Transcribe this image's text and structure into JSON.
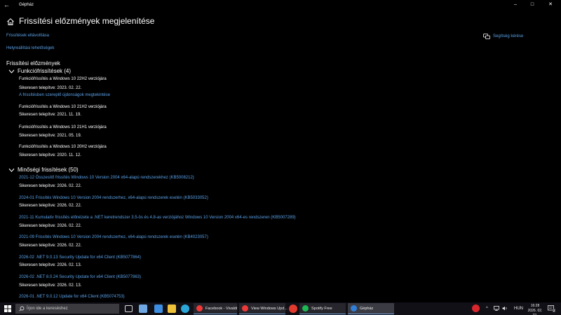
{
  "window": {
    "title": "Gépház",
    "back_glyph": "←",
    "minimize_glyph": "–",
    "maximize_glyph": "□",
    "close_glyph": "✕"
  },
  "header": {
    "title": "Frissítési előzmények megjelenítése"
  },
  "links": {
    "uninstall": "Frissítések eltávolítása",
    "recovery": "Helyreállítási lehetőségek",
    "help": "Segítség kérése"
  },
  "history": {
    "heading": "Frissítési előzmények",
    "feature_group": "Funkciófrissítések (4)",
    "feature_items": [
      {
        "title": "Funkciófrissítés a Windows 10 22H2 verziójára",
        "status": "Sikeresen telepítve: 2023. 02. 22.",
        "extra_link": "A frissítésben szereplő újdonságok megtekintése"
      },
      {
        "title": "Funkciófrissítés a Windows 10 21H2 verziójára",
        "status": "Sikeresen telepítve: 2021. 11. 19."
      },
      {
        "title": "Funkciófrissítés a Windows 10 21H1 verziójára",
        "status": "Sikeresen telepítve: 2021. 05. 19."
      },
      {
        "title": "Funkciófrissítés a Windows 10 20H2 verziójára",
        "status": "Sikeresen telepítve: 2020. 11. 12."
      }
    ],
    "quality_group": "Minőségi frissítések (50)",
    "quality_items": [
      {
        "title": "2021-12 Összesítő frissítés Windows 10 Version 2004 x64-alapú rendszerekhez (KB5008212)",
        "status": "Sikeresen telepítve: 2026. 02. 22."
      },
      {
        "title": "2024-01 Frissítés Windows 10 Version 2004 rendszerhez, x64-alapú rendszerek esetén (KB5033052)",
        "status": "Sikeresen telepítve: 2026. 02. 22."
      },
      {
        "title": "2021-11 Kumulatív frissítés előnézete a .NET keretrendszer 3.5-ös és 4.8-as verziójához Windows 10 Version 2004 x64-es rendszeren (KB5007289)",
        "status": "Sikeresen telepítve: 2026. 02. 22."
      },
      {
        "title": "2021-09 Frissítés Windows 10 Version 2004 rendszerhez, x64-alapú rendszerek esetén (KB4023057)",
        "status": "Sikeresen telepítve: 2026. 02. 22."
      },
      {
        "title": "2026-02 .NET 9.0.13 Security Update for x64 Client (KB5077864)",
        "status": "Sikeresen telepítve: 2026. 02. 13."
      },
      {
        "title": "2026-02 .NET 8.0.24 Security Update for x64 Client (KB5077863)",
        "status": "Sikeresen telepítve: 2026. 02. 13."
      },
      {
        "title": "2026-01 .NET 9.0.12 Update for x64 Client (KB5074753)",
        "status": ""
      }
    ]
  },
  "taskbar": {
    "search_placeholder": "Írjon ide a kereséshez",
    "buttons": [
      {
        "label": "Facebook - Vivaldi",
        "color": "#ef3939"
      },
      {
        "label": "View Windows Upd...",
        "color": "#ef3939"
      },
      {
        "label": "Spotify Free",
        "color": "#1db954"
      },
      {
        "label": "Gépház",
        "color": "#2f7fd8"
      }
    ],
    "language": "HUN",
    "time": "16:28",
    "date": "2026. 02. 22.",
    "chevron_glyph": "^",
    "notif_badge": "2"
  },
  "colors": {
    "background": "#000000",
    "link": "#5aa1e8",
    "accent": "#2f7fd8"
  }
}
